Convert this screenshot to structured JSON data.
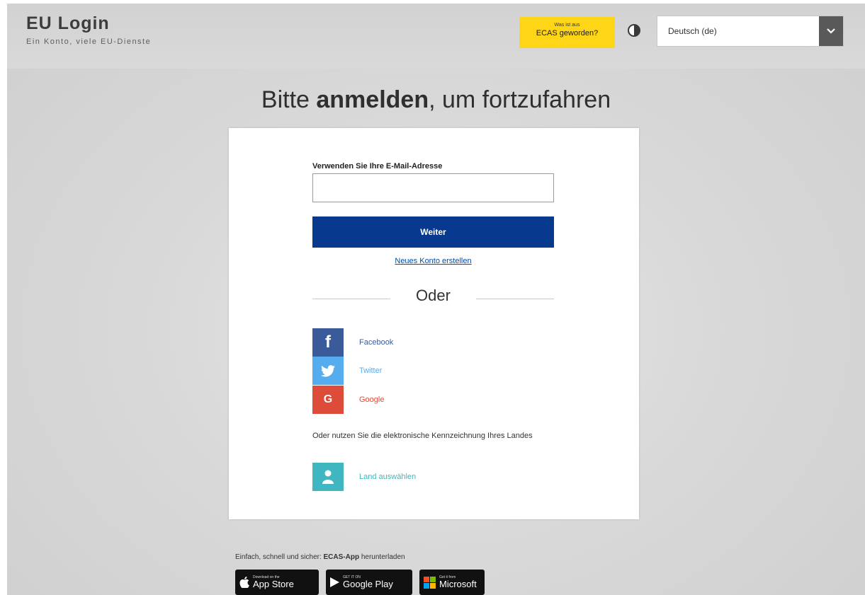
{
  "header": {
    "title": "EU Login",
    "subtitle": "Ein Konto, viele EU-Dienste",
    "ecas_badge": {
      "small": "Was ist aus",
      "big": "ECAS geworden?"
    },
    "language": {
      "selected": "Deutsch (de)"
    }
  },
  "main": {
    "headline_pre": "Bitte ",
    "headline_bold": "anmelden",
    "headline_post": ", um fortzufahren"
  },
  "login": {
    "email_label": "Verwenden Sie Ihre E-Mail-Adresse",
    "email_value": "",
    "continue_label": "Weiter",
    "new_account_link": "Neues Konto erstellen",
    "or_label": "Oder",
    "social": [
      {
        "name": "Facebook",
        "icon": "facebook-icon",
        "color": "#3a5a99"
      },
      {
        "name": "Twitter",
        "icon": "twitter-icon",
        "color": "#55acee"
      },
      {
        "name": "Google",
        "icon": "google-icon",
        "color": "#dd4b39"
      }
    ],
    "eid_text": "Oder nutzen Sie die elektronische Kennzeichnung Ihres Landes",
    "country_link": "Land auswählen"
  },
  "footer": {
    "text_pre": "Einfach, schnell und sicher: ",
    "text_bold": "ECAS-App",
    "text_post": " herunterladen",
    "stores": [
      {
        "tiny": "Download on the",
        "big": "App Store",
        "icon": "apple-icon"
      },
      {
        "tiny": "GET IT ON",
        "big": "Google Play",
        "icon": "google-play-icon"
      },
      {
        "tiny": "Get it from",
        "big": "Microsoft",
        "icon": "microsoft-icon"
      }
    ]
  },
  "colors": {
    "primary_button": "#073a8e",
    "ecas_badge": "#ffd617",
    "link": "#0b4aa0"
  }
}
